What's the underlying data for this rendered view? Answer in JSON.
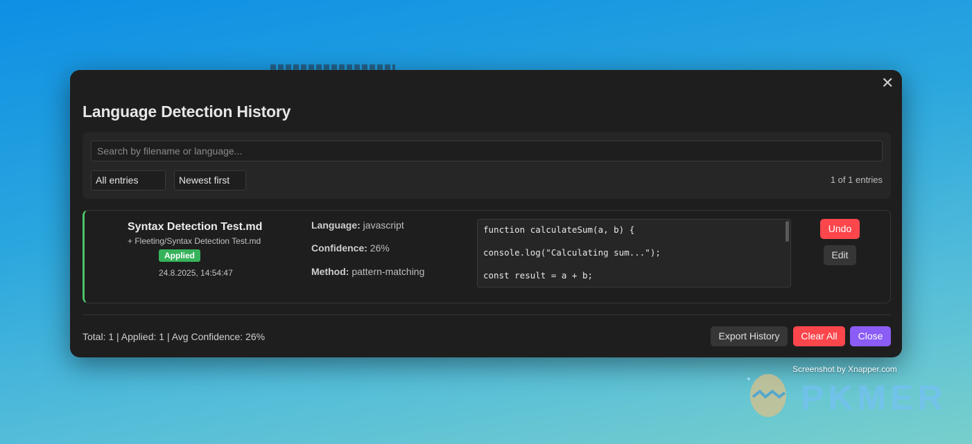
{
  "modal": {
    "title": "Language Detection History",
    "close_glyph": "✕"
  },
  "controls": {
    "search_placeholder": "Search by filename or language...",
    "filter_value": "All entries",
    "sort_value": "Newest first",
    "count_text": "1 of 1 entries"
  },
  "entries": [
    {
      "filename": "Syntax Detection Test.md",
      "path": "+ Fleeting/Syntax Detection Test.md",
      "status": "Applied",
      "timestamp": "24.8.2025, 14:54:47",
      "language_label": "Language:",
      "language": "javascript",
      "confidence_label": "Confidence:",
      "confidence": "26%",
      "method_label": "Method:",
      "method": "pattern-matching",
      "code_lines": [
        "function calculateSum(a, b) {",
        "console.log(\"Calculating sum...\");",
        "const result = a + b;"
      ],
      "undo_label": "Undo",
      "edit_label": "Edit"
    }
  ],
  "footer": {
    "stats": "Total: 1 | Applied: 1 | Avg Confidence: 26%",
    "export_label": "Export History",
    "clear_label": "Clear All",
    "close_label": "Close"
  },
  "colors": {
    "accent": "#8b5cf6",
    "danger": "#fb464c",
    "success": "#36b35a"
  },
  "overlay": {
    "caption": "Screenshot by Xnapper.com",
    "watermark": "PKMER"
  }
}
